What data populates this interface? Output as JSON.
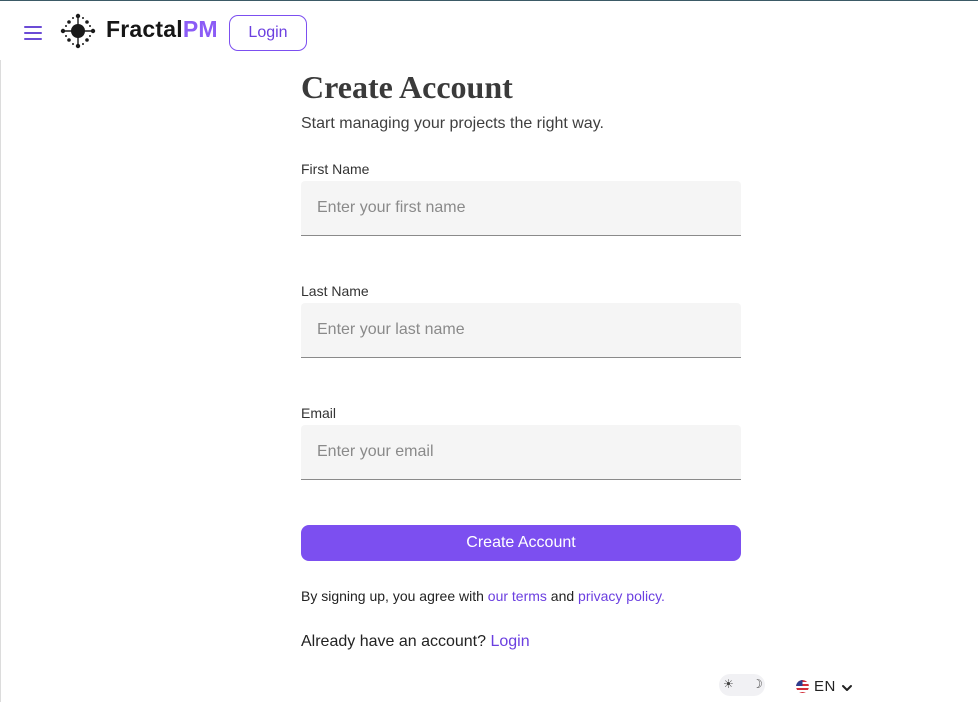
{
  "header": {
    "brand_primary": "Fractal",
    "brand_accent": "PM",
    "login_label": "Login",
    "menu_icon": "hamburger-menu-icon",
    "logo_icon": "fractal-logo-icon"
  },
  "form": {
    "title": "Create Account",
    "subtitle": "Start managing your projects the right way.",
    "fields": [
      {
        "label": "First Name",
        "placeholder": "Enter your first name",
        "value": ""
      },
      {
        "label": "Last Name",
        "placeholder": "Enter your last name",
        "value": ""
      },
      {
        "label": "Email",
        "placeholder": "Enter your email",
        "value": ""
      }
    ],
    "submit_label": "Create Account",
    "terms_prefix": "By signing up, you agree with ",
    "terms_link": "our terms",
    "terms_middle": " and ",
    "privacy_link": "privacy policy.",
    "already_text": "Already have an account? ",
    "already_link": "Login"
  },
  "footer": {
    "theme_light_icon": "sun-icon",
    "theme_dark_icon": "moon-icon",
    "language_code": "EN",
    "language_flag": "us-flag-icon",
    "language_chevron": "chevron-down-icon"
  },
  "colors": {
    "accent": "#7c4ff0",
    "brand_accent": "#8b5cf6",
    "input_bg": "#f5f5f5"
  }
}
